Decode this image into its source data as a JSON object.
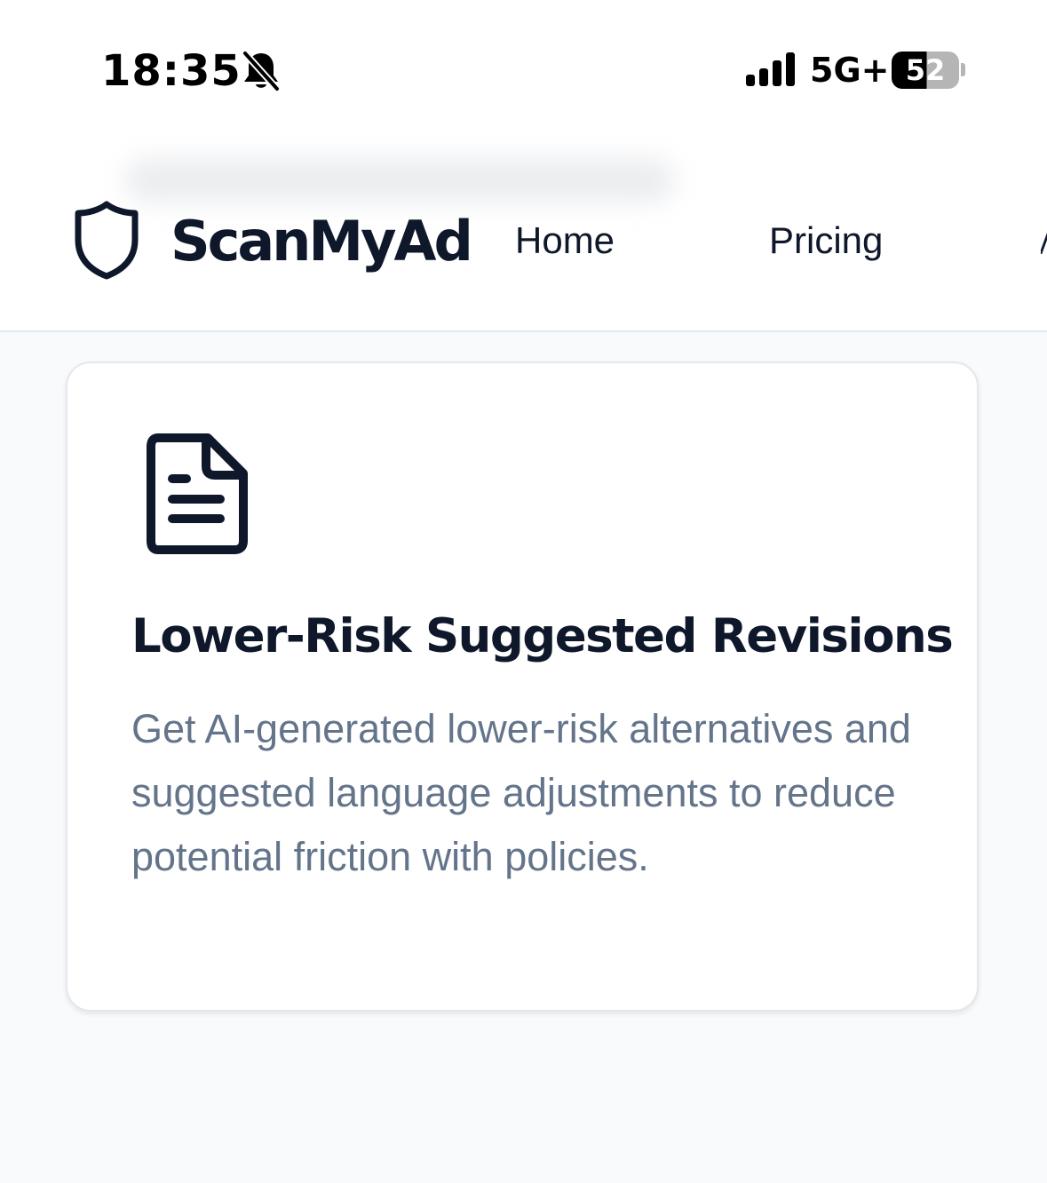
{
  "status_bar": {
    "time": "18:35",
    "network": "5G+",
    "battery": "52",
    "icons": [
      "bell-slash-icon",
      "signal-icon",
      "battery-icon"
    ]
  },
  "nav": {
    "brand": "ScanMyAd",
    "logo_icon": "shield-icon",
    "links": [
      {
        "label": "Home"
      },
      {
        "label": "Pricing"
      }
    ]
  },
  "feature_card": {
    "icon": "document-icon",
    "title": "Lower-Risk Suggested Revisions",
    "description": "Get AI-generated lower-risk alternatives and suggested language adjustments to reduce potential friction with policies."
  },
  "colors": {
    "text_dark": "#0f172a",
    "text_muted": "#64748b",
    "page_background": "#f8fafc",
    "card_background": "#ffffff",
    "border": "#e2e8f0"
  }
}
